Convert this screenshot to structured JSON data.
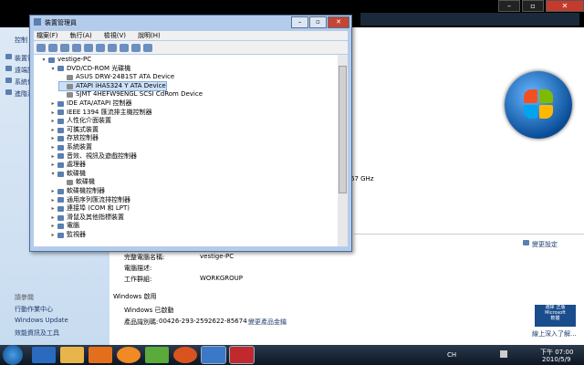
{
  "background": {
    "sidebar": {
      "header": "控制",
      "items": [
        "裝置管",
        "遠端設",
        "系統保",
        "進階系"
      ],
      "see_also": "請參閱",
      "links": [
        "行動作業中心",
        "Windows Update",
        "效能資訊及工具"
      ]
    },
    "content": {
      "cpu_suffix": "67 GHz",
      "settings_link": "變更設定",
      "computer_name_label": "完整電腦名稱:",
      "computer_name": "vestige-PC",
      "description_label": "電腦描述:",
      "workgroup_label": "工作群組:",
      "workgroup": "WORKGROUP",
      "activation_header": "Windows 啟用",
      "activated": "Windows 已啟動",
      "product_id_label": "產品識別碼:",
      "product_id": "00426-293-2592622-85674",
      "change_key": "變更產品金鑰",
      "genuine_badge": [
        "選擇",
        "正版",
        "Microsoft",
        "軟體"
      ],
      "genuine_link": "線上深入了解..."
    }
  },
  "devmgr": {
    "title": "裝置管理員",
    "menu": [
      "檔案(F)",
      "執行(A)",
      "檢視(V)",
      "說明(H)"
    ],
    "tree": [
      {
        "label": "vestige-PC",
        "toggle": "▾",
        "indent": 0
      },
      {
        "label": "DVD/CD-ROM 光碟機",
        "toggle": "▾",
        "indent": 1
      },
      {
        "label": "ASUS DRW-24B1ST ATA Device",
        "toggle": "",
        "indent": 2
      },
      {
        "label": "ATAPI iHAS324   Y ATA Device",
        "toggle": "",
        "indent": 2,
        "selected": true
      },
      {
        "label": "SJMT 4HEFW9ENGL SCSI CdRom Device",
        "toggle": "",
        "indent": 2
      },
      {
        "label": "IDE ATA/ATAPI 控制器",
        "toggle": "▸",
        "indent": 1
      },
      {
        "label": "IEEE 1394 匯流排主機控制器",
        "toggle": "▸",
        "indent": 1
      },
      {
        "label": "人性化介面裝置",
        "toggle": "▸",
        "indent": 1
      },
      {
        "label": "可攜式裝置",
        "toggle": "▸",
        "indent": 1
      },
      {
        "label": "存放控制器",
        "toggle": "▸",
        "indent": 1
      },
      {
        "label": "系統裝置",
        "toggle": "▸",
        "indent": 1
      },
      {
        "label": "音效、視訊及遊戲控制器",
        "toggle": "▸",
        "indent": 1
      },
      {
        "label": "處理器",
        "toggle": "▸",
        "indent": 1
      },
      {
        "label": "軟碟機",
        "toggle": "▾",
        "indent": 1
      },
      {
        "label": "軟碟機",
        "toggle": "",
        "indent": 2
      },
      {
        "label": "軟碟機控制器",
        "toggle": "▸",
        "indent": 1
      },
      {
        "label": "通用序列匯流排控制器",
        "toggle": "▸",
        "indent": 1
      },
      {
        "label": "連接埠 (COM 和 LPT)",
        "toggle": "▸",
        "indent": 1
      },
      {
        "label": "滑鼠及其他指標裝置",
        "toggle": "▸",
        "indent": 1
      },
      {
        "label": "電腦",
        "toggle": "▸",
        "indent": 1
      },
      {
        "label": "監視器",
        "toggle": "▸",
        "indent": 1
      }
    ]
  },
  "taskbar": {
    "lang": "CH",
    "time": "下午 07:00",
    "date": "2010/5/9",
    "apps": [
      "start-orb",
      "ie-icon",
      "explorer-icon",
      "media-player-icon",
      "app-orange-icon",
      "messenger-icon",
      "firefox-icon",
      "app-red-icon",
      "control-panel-icon",
      "toolbox-icon"
    ]
  }
}
